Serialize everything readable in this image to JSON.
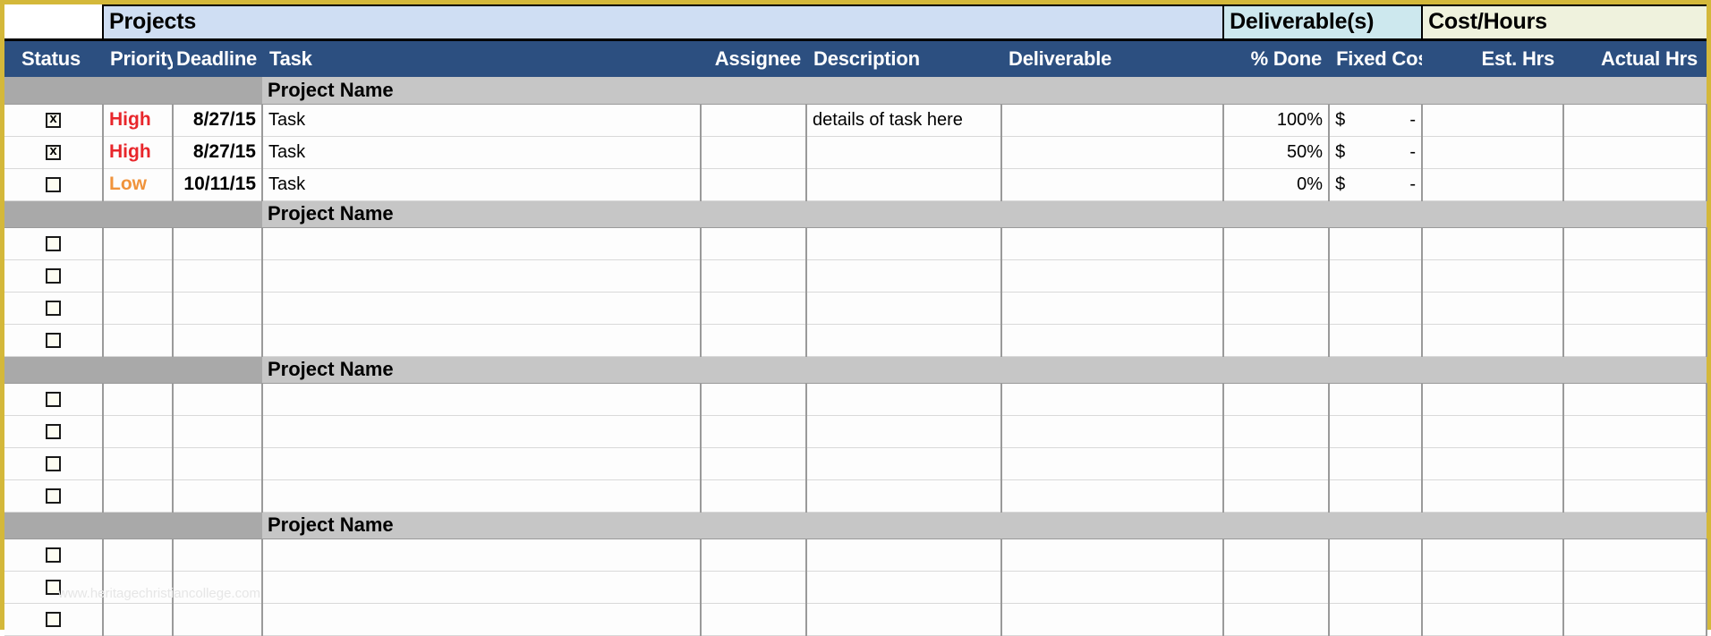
{
  "bands": [
    {
      "name": "blank",
      "label": ""
    },
    {
      "name": "projects",
      "label": "Projects"
    },
    {
      "name": "deliverables",
      "label": "Deliverable(s)"
    },
    {
      "name": "cost_hours",
      "label": "Cost/Hours"
    }
  ],
  "columns": [
    {
      "key": "status",
      "label": "Status",
      "align": "center"
    },
    {
      "key": "priority",
      "label": "Priority",
      "align": "left"
    },
    {
      "key": "deadline",
      "label": "Deadline",
      "align": "right"
    },
    {
      "key": "task",
      "label": "Task",
      "align": "left"
    },
    {
      "key": "assignee",
      "label": "Assignee",
      "align": "right"
    },
    {
      "key": "description",
      "label": "Description",
      "align": "left"
    },
    {
      "key": "deliverable",
      "label": "Deliverable",
      "align": "left"
    },
    {
      "key": "percent_done",
      "label": "% Done",
      "align": "right"
    },
    {
      "key": "fixed_cost",
      "label": "Fixed Cost",
      "align": "left"
    },
    {
      "key": "est_hrs",
      "label": "Est. Hrs",
      "align": "right"
    },
    {
      "key": "actual_hrs",
      "label": "Actual Hrs",
      "align": "right"
    }
  ],
  "groups": [
    {
      "group_label": "Project Name",
      "rows": [
        {
          "status": "checked",
          "priority": "High",
          "priority_color": "high",
          "deadline": "8/27/15",
          "task": "Task",
          "assignee": "",
          "description": "details of task here",
          "deliverable": "",
          "percent_done": "100%",
          "cost_symbol": "$",
          "cost_value": "-",
          "est_hrs": "",
          "actual_hrs": ""
        },
        {
          "status": "checked",
          "priority": "High",
          "priority_color": "high",
          "deadline": "8/27/15",
          "task": "Task",
          "assignee": "",
          "description": "",
          "deliverable": "",
          "percent_done": "50%",
          "cost_symbol": "$",
          "cost_value": "-",
          "est_hrs": "",
          "actual_hrs": ""
        },
        {
          "status": "unchecked",
          "priority": "Low",
          "priority_color": "low",
          "deadline": "10/11/15",
          "task": "Task",
          "assignee": "",
          "description": "",
          "deliverable": "",
          "percent_done": "0%",
          "cost_symbol": "$",
          "cost_value": "-",
          "est_hrs": "",
          "actual_hrs": ""
        }
      ]
    },
    {
      "group_label": "Project Name",
      "rows": [
        {
          "status": "unchecked",
          "priority": "",
          "priority_color": "",
          "deadline": "",
          "task": "",
          "assignee": "",
          "description": "",
          "deliverable": "",
          "percent_done": "",
          "cost_symbol": "",
          "cost_value": "",
          "est_hrs": "",
          "actual_hrs": ""
        },
        {
          "status": "unchecked",
          "priority": "",
          "priority_color": "",
          "deadline": "",
          "task": "",
          "assignee": "",
          "description": "",
          "deliverable": "",
          "percent_done": "",
          "cost_symbol": "",
          "cost_value": "",
          "est_hrs": "",
          "actual_hrs": ""
        },
        {
          "status": "unchecked",
          "priority": "",
          "priority_color": "",
          "deadline": "",
          "task": "",
          "assignee": "",
          "description": "",
          "deliverable": "",
          "percent_done": "",
          "cost_symbol": "",
          "cost_value": "",
          "est_hrs": "",
          "actual_hrs": ""
        },
        {
          "status": "unchecked",
          "priority": "",
          "priority_color": "",
          "deadline": "",
          "task": "",
          "assignee": "",
          "description": "",
          "deliverable": "",
          "percent_done": "",
          "cost_symbol": "",
          "cost_value": "",
          "est_hrs": "",
          "actual_hrs": ""
        }
      ]
    },
    {
      "group_label": "Project Name",
      "rows": [
        {
          "status": "unchecked",
          "priority": "",
          "priority_color": "",
          "deadline": "",
          "task": "",
          "assignee": "",
          "description": "",
          "deliverable": "",
          "percent_done": "",
          "cost_symbol": "",
          "cost_value": "",
          "est_hrs": "",
          "actual_hrs": ""
        },
        {
          "status": "unchecked",
          "priority": "",
          "priority_color": "",
          "deadline": "",
          "task": "",
          "assignee": "",
          "description": "",
          "deliverable": "",
          "percent_done": "",
          "cost_symbol": "",
          "cost_value": "",
          "est_hrs": "",
          "actual_hrs": ""
        },
        {
          "status": "unchecked",
          "priority": "",
          "priority_color": "",
          "deadline": "",
          "task": "",
          "assignee": "",
          "description": "",
          "deliverable": "",
          "percent_done": "",
          "cost_symbol": "",
          "cost_value": "",
          "est_hrs": "",
          "actual_hrs": ""
        },
        {
          "status": "unchecked",
          "priority": "",
          "priority_color": "",
          "deadline": "",
          "task": "",
          "assignee": "",
          "description": "",
          "deliverable": "",
          "percent_done": "",
          "cost_symbol": "",
          "cost_value": "",
          "est_hrs": "",
          "actual_hrs": ""
        }
      ]
    },
    {
      "group_label": "Project Name",
      "rows": [
        {
          "status": "unchecked",
          "priority": "",
          "priority_color": "",
          "deadline": "",
          "task": "",
          "assignee": "",
          "description": "",
          "deliverable": "",
          "percent_done": "",
          "cost_symbol": "",
          "cost_value": "",
          "est_hrs": "",
          "actual_hrs": ""
        },
        {
          "status": "unchecked",
          "priority": "",
          "priority_color": "",
          "deadline": "",
          "task": "",
          "assignee": "",
          "description": "",
          "deliverable": "",
          "percent_done": "",
          "cost_symbol": "",
          "cost_value": "",
          "est_hrs": "",
          "actual_hrs": ""
        },
        {
          "status": "unchecked",
          "priority": "",
          "priority_color": "",
          "deadline": "",
          "task": "",
          "assignee": "",
          "description": "",
          "deliverable": "",
          "percent_done": "",
          "cost_symbol": "",
          "cost_value": "",
          "est_hrs": "",
          "actual_hrs": ""
        }
      ]
    }
  ],
  "watermark": "www.heritagechristiancollege.com",
  "colors": {
    "frame": "#d4b83a",
    "header_blue": "#2c4f80",
    "band_projects": "#cfdef3",
    "band_deliverables": "#cde8ee",
    "band_cost": "#eff2dd",
    "group_dark": "#a9a9a9",
    "group_light": "#c6c6c6",
    "priority_high": "#e8262b",
    "priority_low": "#f0933b"
  }
}
